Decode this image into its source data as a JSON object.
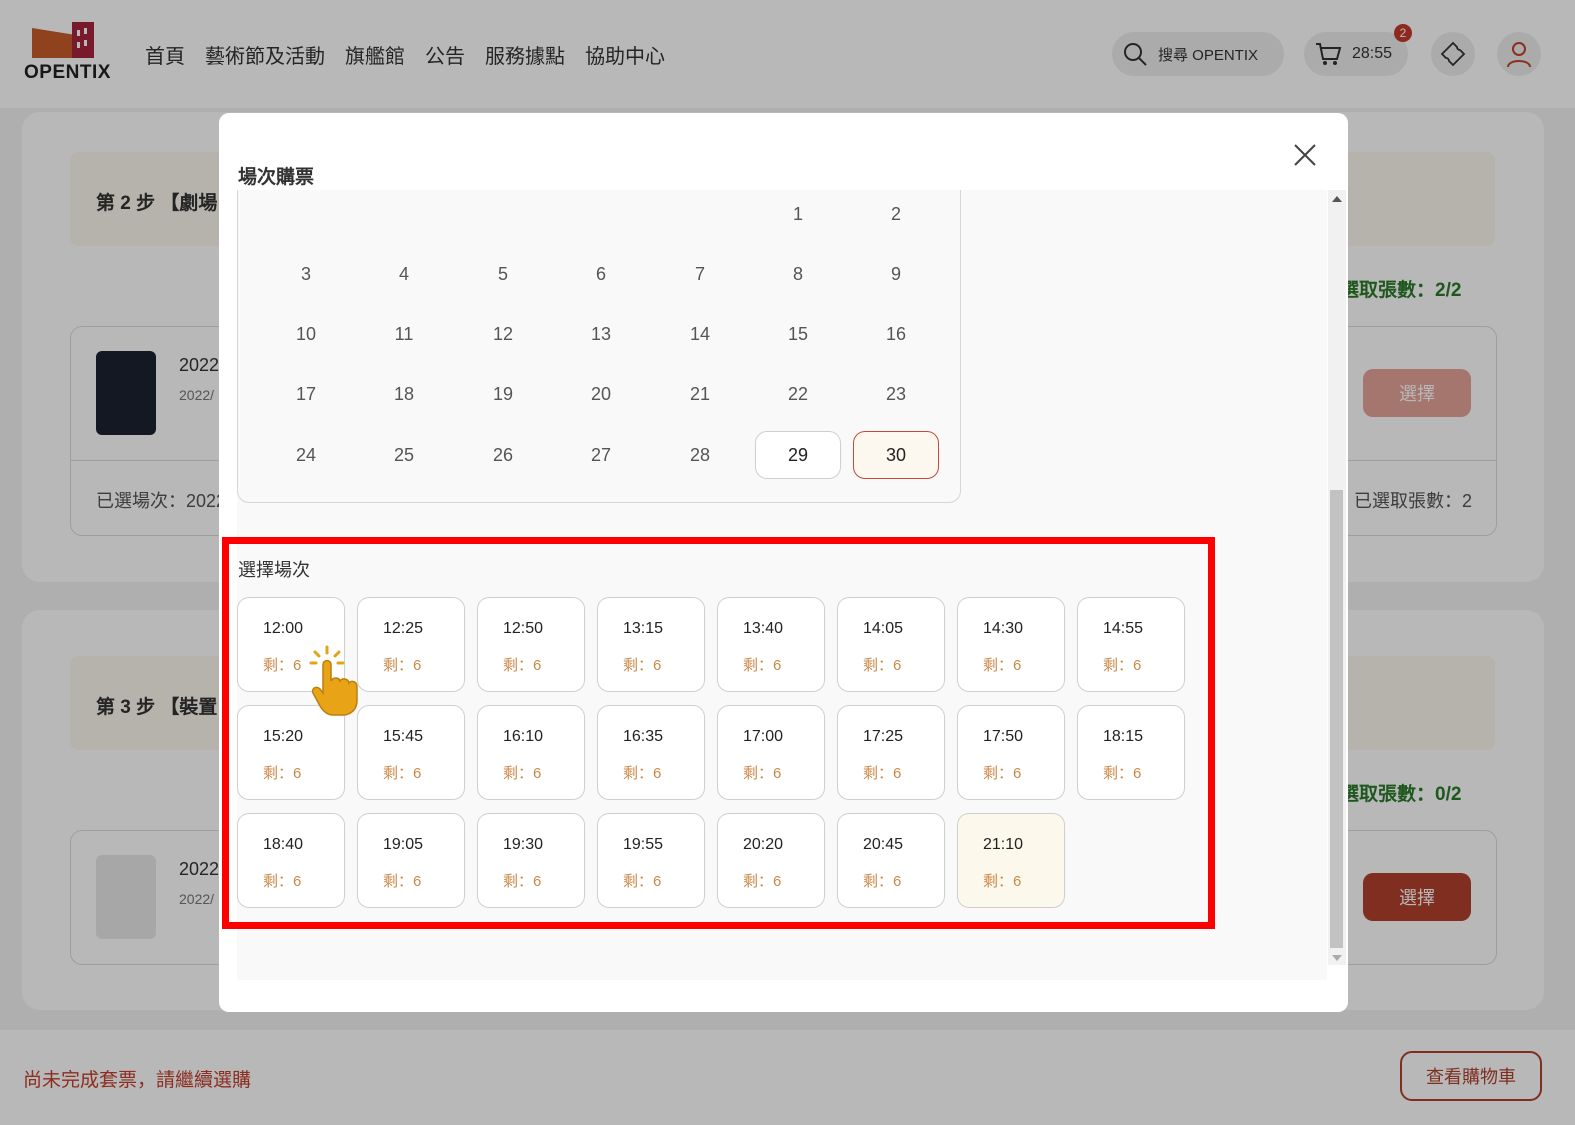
{
  "header": {
    "logo_text": "OPENTIX",
    "nav": [
      "首頁",
      "藝術節及活動",
      "旗艦館",
      "公告",
      "服務據點",
      "協助中心"
    ],
    "search_label": "搜尋 OPENTIX",
    "cart_timer": "28:55",
    "cart_badge": "2"
  },
  "background": {
    "step2": "第 2 步 【劇場",
    "step3": "第 3 步 【裝置",
    "count2": "選取張數：2/2",
    "count3": "選取張數：0/2",
    "item1_year": "2022",
    "item1_date": "2022/",
    "item2_year": "2022",
    "item2_date": "2022/",
    "selected_session": "已選場次：2022",
    "selected_count": "已選取張數：2",
    "select_label": "選擇"
  },
  "footer": {
    "message": "尚未完成套票，請繼續選購",
    "cart_button": "查看購物車"
  },
  "modal": {
    "title": "場次購票",
    "calendar_rows": [
      [
        "",
        "",
        "",
        "",
        "",
        "1",
        "2"
      ],
      [
        "3",
        "4",
        "5",
        "6",
        "7",
        "8",
        "9"
      ],
      [
        "10",
        "11",
        "12",
        "13",
        "14",
        "15",
        "16"
      ],
      [
        "17",
        "18",
        "19",
        "20",
        "21",
        "22",
        "23"
      ],
      [
        "24",
        "25",
        "26",
        "27",
        "28",
        "29",
        "30"
      ]
    ],
    "available_days": [
      "29",
      "30"
    ],
    "selected_day": "30",
    "session_title": "選擇場次",
    "sessions": [
      {
        "time": "12:00",
        "remain": "剩：6"
      },
      {
        "time": "12:25",
        "remain": "剩：6"
      },
      {
        "time": "12:50",
        "remain": "剩：6"
      },
      {
        "time": "13:15",
        "remain": "剩：6"
      },
      {
        "time": "13:40",
        "remain": "剩：6"
      },
      {
        "time": "14:05",
        "remain": "剩：6"
      },
      {
        "time": "14:30",
        "remain": "剩：6"
      },
      {
        "time": "14:55",
        "remain": "剩：6"
      },
      {
        "time": "15:20",
        "remain": "剩：6"
      },
      {
        "time": "15:45",
        "remain": "剩：6"
      },
      {
        "time": "16:10",
        "remain": "剩：6"
      },
      {
        "time": "16:35",
        "remain": "剩：6"
      },
      {
        "time": "17:00",
        "remain": "剩：6"
      },
      {
        "time": "17:25",
        "remain": "剩：6"
      },
      {
        "time": "17:50",
        "remain": "剩：6"
      },
      {
        "time": "18:15",
        "remain": "剩：6"
      },
      {
        "time": "18:40",
        "remain": "剩：6"
      },
      {
        "time": "19:05",
        "remain": "剩：6"
      },
      {
        "time": "19:30",
        "remain": "剩：6"
      },
      {
        "time": "19:55",
        "remain": "剩：6"
      },
      {
        "time": "20:20",
        "remain": "剩：6"
      },
      {
        "time": "20:45",
        "remain": "剩：6"
      },
      {
        "time": "21:10",
        "remain": "剩：6"
      }
    ],
    "selected_session": "21:10"
  },
  "colors": {
    "brand": "#b0412d",
    "highlight": "#ff0000",
    "remain_text": "#c9894a",
    "count_green": "#2c7a2c"
  }
}
